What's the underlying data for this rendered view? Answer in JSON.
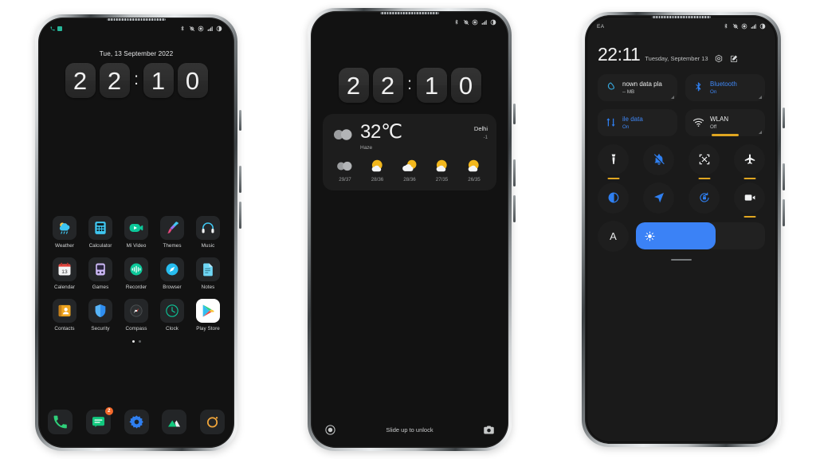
{
  "background_color": "#ffffff",
  "accent_colors": {
    "blue": "#3b82f6",
    "tile_blue_text": "#3f87f5",
    "underline_yellow": "#e0a621",
    "badge_orange": "#f4692a",
    "teal": "#27b79a"
  },
  "phone1": {
    "name": "home-screen",
    "statusbar": {
      "left_icons": [
        "phone-call-icon",
        "sim-card-icon"
      ],
      "right_icons": [
        "bluetooth-icon",
        "vibrate-off-icon",
        "dnd-icon",
        "signal-bars-icon",
        "battery-icon"
      ]
    },
    "lockscreen": {
      "date": "Tue, 13 September 2022",
      "time_digits": [
        "2",
        "2",
        "1",
        "0"
      ],
      "colon": ":"
    },
    "apps": [
      [
        {
          "label": "Weather",
          "icon": "weather-icon"
        },
        {
          "label": "Calculator",
          "icon": "calculator-icon"
        },
        {
          "label": "Mi Video",
          "icon": "mi-video-icon"
        },
        {
          "label": "Themes",
          "icon": "themes-icon"
        },
        {
          "label": "Music",
          "icon": "music-icon"
        }
      ],
      [
        {
          "label": "Calendar",
          "icon": "calendar-icon"
        },
        {
          "label": "Games",
          "icon": "games-icon"
        },
        {
          "label": "Recorder",
          "icon": "recorder-icon"
        },
        {
          "label": "Browser",
          "icon": "browser-icon"
        },
        {
          "label": "Notes",
          "icon": "notes-icon"
        }
      ],
      [
        {
          "label": "Contacts",
          "icon": "contacts-icon"
        },
        {
          "label": "Security",
          "icon": "security-icon"
        },
        {
          "label": "Compass",
          "icon": "compass-icon"
        },
        {
          "label": "Clock",
          "icon": "clock-icon"
        },
        {
          "label": "Play Store",
          "icon": "play-store-icon"
        }
      ]
    ],
    "page_dots": {
      "count": 2,
      "active_index": 0
    },
    "dock": [
      {
        "icon": "phone-icon",
        "badge": ""
      },
      {
        "icon": "messages-icon",
        "badge": "2"
      },
      {
        "icon": "settings-gear-icon",
        "badge": ""
      },
      {
        "icon": "gallery-icon",
        "badge": ""
      },
      {
        "icon": "browser-ring-icon",
        "badge": ""
      }
    ]
  },
  "phone2": {
    "name": "lock-screen-with-weather",
    "statusbar": {
      "right_icons": [
        "bluetooth-icon",
        "vibrate-off-icon",
        "dnd-icon",
        "signal-bars-icon",
        "battery-icon"
      ]
    },
    "time_digits": [
      "2",
      "2",
      "1",
      "0"
    ],
    "colon": ":",
    "weather": {
      "temperature": "32℃",
      "condition": "Haze",
      "city": "Delhi",
      "aqi": "-1",
      "current_icon": "haze-icon",
      "forecast": [
        {
          "icon": "haze-icon",
          "range": "29/37"
        },
        {
          "icon": "sunny-icon",
          "range": "28/36"
        },
        {
          "icon": "cloudy-icon",
          "range": "28/36"
        },
        {
          "icon": "sunny-icon",
          "range": "27/35"
        },
        {
          "icon": "sunny-icon",
          "range": "26/35"
        }
      ]
    },
    "unlock_hint": "Slide up to unlock",
    "left_icon": "fingerprint-icon",
    "right_icon": "camera-icon"
  },
  "phone3": {
    "name": "control-center",
    "statusbar": {
      "carrier": "EA",
      "right_icons": [
        "bluetooth-icon",
        "vibrate-off-icon",
        "dnd-icon",
        "signal-bars-icon",
        "battery-icon"
      ]
    },
    "time": "22:11",
    "date": "Tuesday, September 13",
    "header_icons": [
      "settings-hex-icon",
      "edit-icon"
    ],
    "tiles": [
      {
        "title": "nown data pla",
        "sub": "-- MB",
        "icon": "data-usage-icon",
        "style": "white",
        "underline": false
      },
      {
        "title": "Bluetooth",
        "sub": "On",
        "icon": "bluetooth-icon",
        "style": "blue",
        "underline": false
      },
      {
        "title": "ile data",
        "sub": "On",
        "icon": "mobile-data-icon",
        "style": "blue",
        "underline": false
      },
      {
        "title": "WLAN",
        "sub": "Off",
        "icon": "wifi-icon",
        "style": "white",
        "underline": true
      }
    ],
    "small_buttons": [
      {
        "icon": "flashlight-icon",
        "underline": true
      },
      {
        "icon": "bell-off-icon",
        "underline": false
      },
      {
        "icon": "screenshot-icon",
        "underline": true
      },
      {
        "icon": "airplane-icon",
        "underline": true
      },
      {
        "icon": "dark-mode-icon",
        "underline": false
      },
      {
        "icon": "location-arrow-icon",
        "underline": false
      },
      {
        "icon": "rotation-lock-icon",
        "underline": false
      },
      {
        "icon": "screen-record-icon",
        "underline": true
      }
    ],
    "brightness": {
      "auto_label": "A",
      "icon": "sun-icon",
      "value_percent": 62
    }
  }
}
